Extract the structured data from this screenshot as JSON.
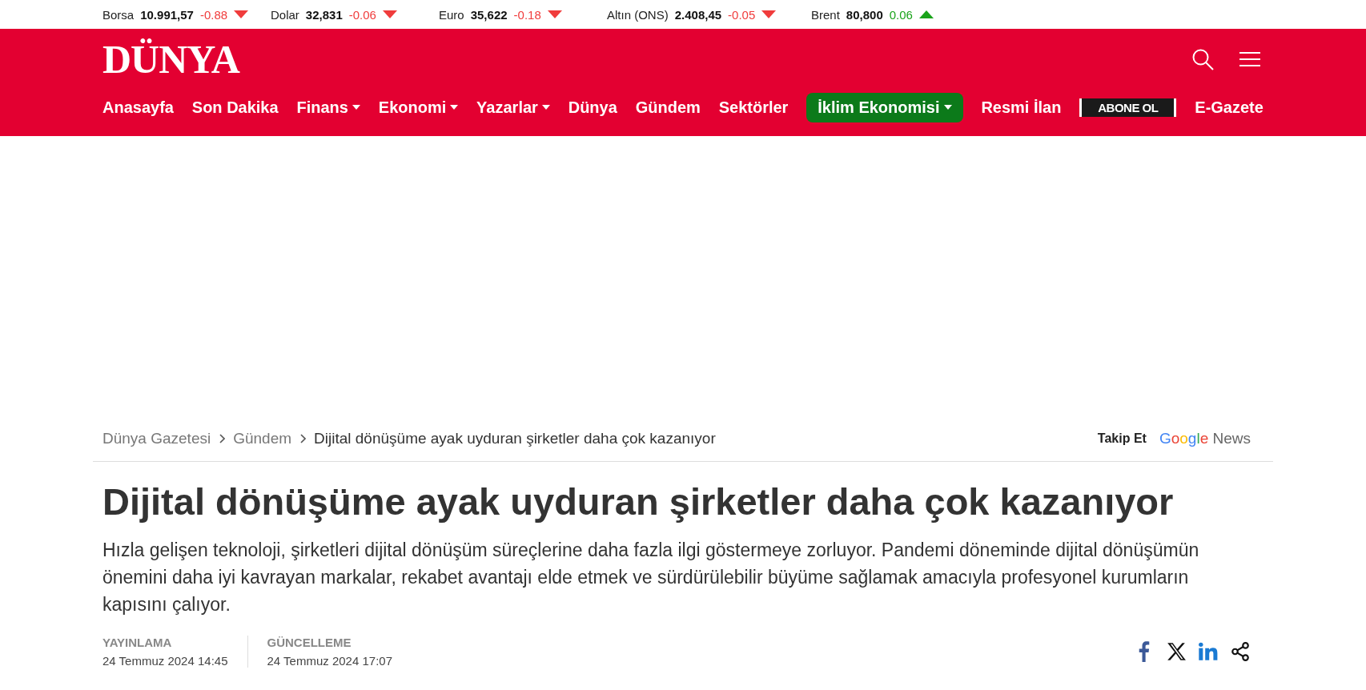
{
  "ticker": [
    {
      "name": "Borsa",
      "value": "10.991,57",
      "change": "-0.88",
      "rising": false
    },
    {
      "name": "Dolar",
      "value": "32,831",
      "change": "-0.06",
      "rising": false
    },
    {
      "name": "Euro",
      "value": "35,622",
      "change": "-0.18",
      "rising": false
    },
    {
      "name": "Altın (ONS)",
      "value": "2.408,45",
      "change": "-0.05",
      "rising": false
    },
    {
      "name": "Brent",
      "value": "80,800",
      "change": "0.06",
      "rising": true
    }
  ],
  "header": {
    "logo": "DÜNYA",
    "nav": [
      {
        "label": "Anasayfa",
        "kind": "link",
        "dropdown": false
      },
      {
        "label": "Son Dakika",
        "kind": "link",
        "dropdown": false
      },
      {
        "label": "Finans",
        "kind": "link",
        "dropdown": true
      },
      {
        "label": "Ekonomi",
        "kind": "link",
        "dropdown": true
      },
      {
        "label": "Yazarlar",
        "kind": "link",
        "dropdown": true
      },
      {
        "label": "Dünya",
        "kind": "link",
        "dropdown": false
      },
      {
        "label": "Gündem",
        "kind": "link",
        "dropdown": false
      },
      {
        "label": "Sektörler",
        "kind": "link",
        "dropdown": false
      },
      {
        "label": "İklim Ekonomisi",
        "kind": "highlight",
        "dropdown": true
      },
      {
        "label": "Resmi İlan",
        "kind": "link",
        "dropdown": false
      },
      {
        "label": "ABONE OL",
        "kind": "badge",
        "dropdown": false
      },
      {
        "label": "E-Gazete",
        "kind": "link",
        "dropdown": false
      }
    ]
  },
  "breadcrumb": [
    "Dünya Gazetesi",
    "Gündem",
    "Dijital dönüşüme ayak uyduran şirketler daha çok kazanıyor"
  ],
  "follow": {
    "label": "Takip Et",
    "brand": "Google",
    "product": "News"
  },
  "article": {
    "title": "Dijital dönüşüme ayak uyduran şirketler daha çok kazanıyor",
    "summary": "Hızla gelişen teknoloji, şirketleri dijital dönüşüm süreçlerine daha fazla ilgi göstermeye zorluyor. Pandemi döneminde dijital dönüşümün önemini daha iyi kavrayan markalar, rekabet avantajı elde etmek ve sürdürülebilir büyüme sağlamak amacıyla profesyonel kurumların kapısını çalıyor.",
    "dates": [
      {
        "label": "YAYINLAMA",
        "value": "24 Temmuz 2024 14:45"
      },
      {
        "label": "GÜNCELLEME",
        "value": "24 Temmuz 2024 17:07"
      }
    ],
    "share": [
      {
        "kind": "facebook"
      },
      {
        "kind": "x"
      },
      {
        "kind": "linkedin"
      },
      {
        "kind": "share"
      }
    ]
  }
}
